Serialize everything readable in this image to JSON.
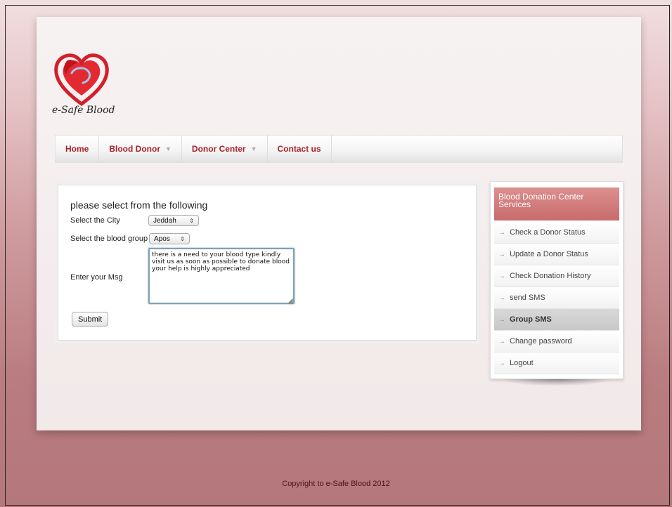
{
  "site": {
    "logo_text": "e-Safe Blood"
  },
  "nav": {
    "items": [
      {
        "label": "Home",
        "has_dropdown": false
      },
      {
        "label": "Blood Donor",
        "has_dropdown": true
      },
      {
        "label": "Donor Center",
        "has_dropdown": true
      },
      {
        "label": "Contact us",
        "has_dropdown": false
      }
    ]
  },
  "form": {
    "title": "please select from the following",
    "city_label": "Select the City",
    "city_value": "Jeddah",
    "blood_group_label": "Select the blood group",
    "blood_group_value": "Apos",
    "msg_label": "Enter your Msg",
    "msg_value": "there is a need to your blood type kindly visit us as soon as possible to donate blood your help is highly appreciated",
    "submit_label": "Submit"
  },
  "sidebar": {
    "title": "Blood Donation Center Services",
    "items": [
      {
        "label": "Check a Donor Status"
      },
      {
        "label": "Update a Donor Status"
      },
      {
        "label": "Check Donation History"
      },
      {
        "label": "send SMS"
      },
      {
        "label": "Group SMS"
      },
      {
        "label": "Change password"
      },
      {
        "label": "Logout"
      }
    ],
    "active_item": "Group SMS"
  },
  "footer": {
    "text": "Copyright to e-Safe Blood 2012"
  },
  "colors": {
    "accent": "#a8232b",
    "sidebar_header": "#c86b6c"
  }
}
